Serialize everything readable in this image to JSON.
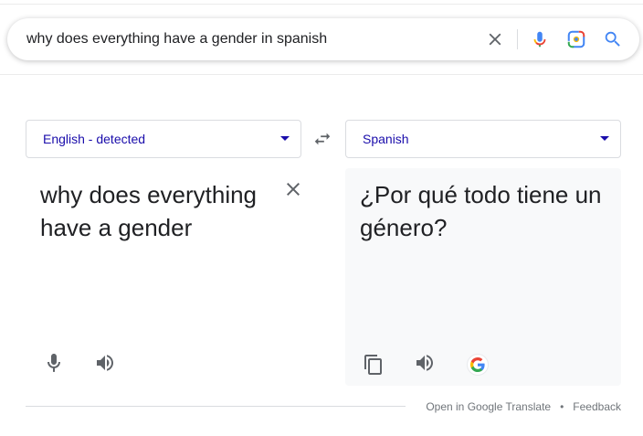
{
  "search": {
    "query": "why does everything have a gender in spanish"
  },
  "header": {
    "feedback_label": "Feedback"
  },
  "translator": {
    "source_language": "English - detected",
    "target_language": "Spanish",
    "source_text": "why does everything have a gender",
    "translated_text": "¿Por qué todo tiene un género?"
  },
  "footer": {
    "open_translate_label": "Open in Google Translate",
    "separator": "•",
    "feedback_label": "Feedback"
  },
  "icons": {
    "clear": "close-icon",
    "voice": "microphone-icon",
    "lens": "camera-lens-icon",
    "search": "search-icon",
    "swap": "swap-icon",
    "speaker": "speaker-icon",
    "copy": "copy-icon",
    "google": "google-g-icon"
  },
  "colors": {
    "accent_blue": "#1a73e8",
    "link_blue": "#1a0dab",
    "icon_grey": "#5f6368",
    "mic_red": "#ea4335",
    "mic_blue": "#4285f4",
    "google_yellow": "#fbbc05",
    "google_green": "#34a853"
  }
}
